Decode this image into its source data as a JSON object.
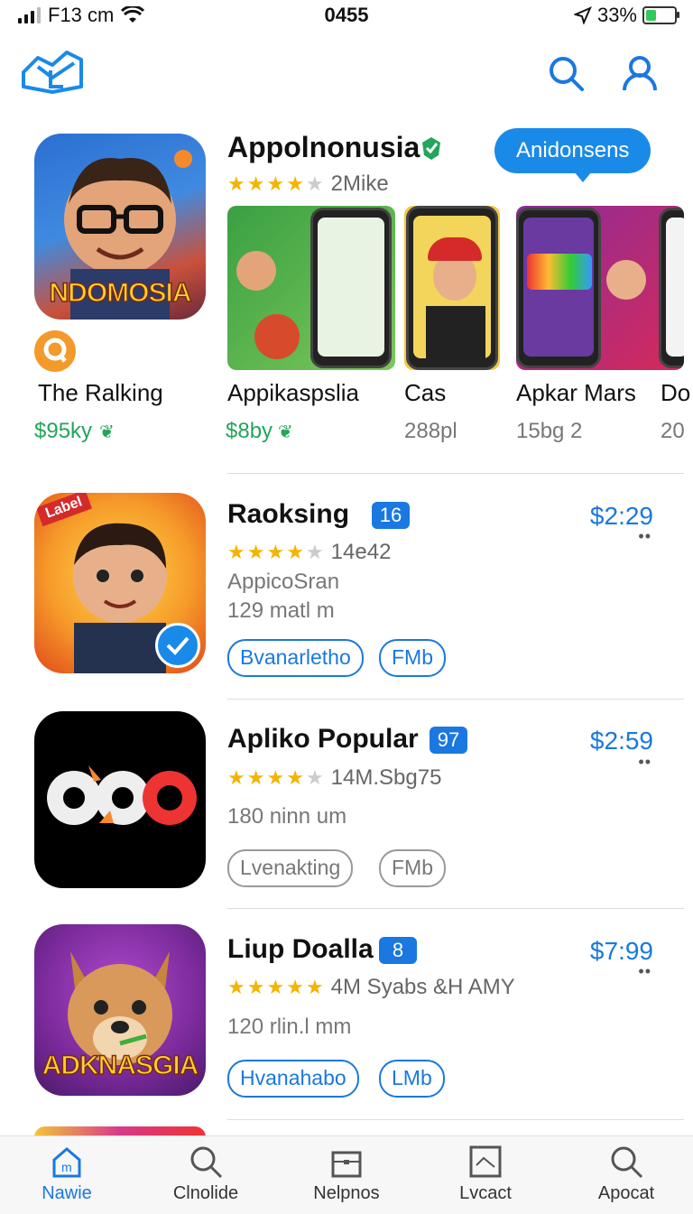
{
  "status": {
    "carrier": "F13 cm",
    "time": "0455",
    "battery": "33%"
  },
  "featured": {
    "icon_text": "NDOMOSIA",
    "title": "Appolnonusia",
    "rating_count": "2Mike",
    "bubble": "Anidonsens",
    "items": [
      {
        "name": "The Ralking",
        "price": "$95ky"
      },
      {
        "name": "Appikaspslia",
        "price": "$8by"
      },
      {
        "name": "Cas",
        "price": "288pl"
      },
      {
        "name": "Apkar Mars",
        "price": "15bg 2"
      },
      {
        "name": "Do",
        "price": "20"
      }
    ]
  },
  "rows": [
    {
      "title": "Raoksing",
      "badge": "16",
      "price": "$2:29",
      "rating_count": "14e42",
      "sub1": "AppicoSran",
      "sub2": "129 matl m",
      "pill1": "Bvanarletho",
      "pill2": "FMb",
      "icon_label": "Label"
    },
    {
      "title": "Apliko Popular",
      "badge": "97",
      "price": "$2:59",
      "rating_count": "14M.Sbg75",
      "sub1": "180 ninn um",
      "pill1": "Lvenakting",
      "pill2": "FMb"
    },
    {
      "title": "Liup Doalla",
      "badge": "8",
      "price": "$7:99",
      "rating_count": "4M Syabs &H AMY",
      "sub1": "120 rlin.l mm",
      "pill1": "Hvanahabo",
      "pill2": "LMb",
      "icon_text": "ADKNASGIA"
    }
  ],
  "tabs": [
    {
      "label": "Nawie",
      "icon": "home-icon"
    },
    {
      "label": "Clnolide",
      "icon": "search-icon"
    },
    {
      "label": "Nelpnos",
      "icon": "briefcase-icon"
    },
    {
      "label": "Lvcact",
      "icon": "message-icon"
    },
    {
      "label": "Apocat",
      "icon": "search-icon"
    }
  ],
  "colors": {
    "accent": "#1a78e0",
    "green": "#23a55a",
    "star": "#f5b400"
  }
}
